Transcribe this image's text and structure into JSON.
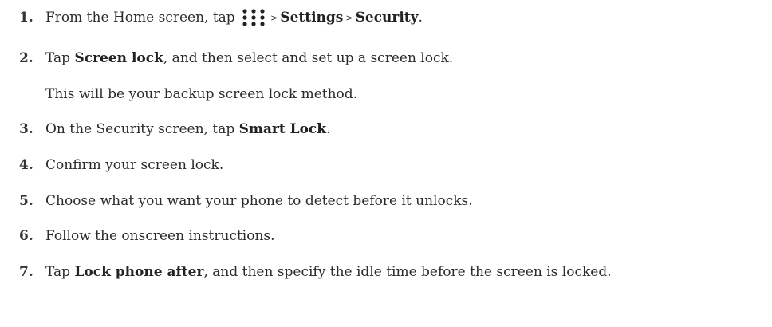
{
  "steps": [
    {
      "number": "1.",
      "prefix": "From the Home screen, tap",
      "icon": "apps-grid-icon",
      "separator": ">",
      "settings": "Settings",
      "security": "Security",
      "end": "."
    },
    {
      "number": "2.",
      "prefix": "Tap ",
      "bold": "Screen lock",
      "suffix": ", and then select and set up a screen lock.",
      "note": "This will be your backup screen lock method."
    },
    {
      "number": "3.",
      "prefix": "On the Security screen, tap ",
      "bold": "Smart Lock",
      "suffix": "."
    },
    {
      "number": "4.",
      "text": "Confirm your screen lock."
    },
    {
      "number": "5.",
      "text": "Choose what you want your phone to detect before it unlocks."
    },
    {
      "number": "6.",
      "text": "Follow the onscreen instructions."
    },
    {
      "number": "7.",
      "prefix": "Tap ",
      "bold": "Lock phone after",
      "suffix": ", and then specify the idle time before the screen is locked."
    }
  ],
  "colors": {
    "text": "#2b2b2b",
    "background": "#ffffff"
  }
}
